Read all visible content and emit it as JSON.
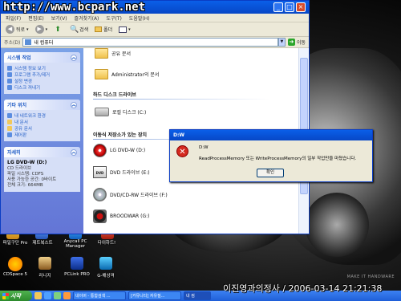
{
  "watermark": {
    "site": "http://www.bcpark.net",
    "caption": "이진영과의정사 / 2006-03-14 21:21:38"
  },
  "wallpaper": {
    "brand": "MAKE IT HANDWARE"
  },
  "explorer": {
    "window_controls": [
      "_",
      "□",
      "×"
    ],
    "menu": [
      "파일(F)",
      "편집(E)",
      "보기(V)",
      "즐겨찾기(A)",
      "도구(T)",
      "도움말(H)"
    ],
    "toolbar": {
      "back": "뒤로",
      "forward": "",
      "search": "검색",
      "folders": "폴더"
    },
    "address": {
      "label": "주소(D)",
      "value": "내 컴퓨터",
      "go": "이동"
    },
    "tasks": {
      "system": {
        "title": "시스템 작업",
        "items": [
          "시스템 정보 보기",
          "프로그램 추가/제거",
          "설정 변경",
          "디스크 꺼내기"
        ]
      },
      "other": {
        "title": "기타 위치",
        "items": [
          "내 네트워크 환경",
          "내 문서",
          "공유 문서",
          "제어판"
        ]
      },
      "details": {
        "title": "자세히",
        "lines": [
          "LG DVD-W (D:)",
          "CD 드라이브",
          "파일 시스템: CDFS",
          "사용 가능한 공간: 0바이트",
          "전체 크기: 664MB"
        ]
      }
    },
    "items": {
      "shared_docs": "공유 문서",
      "admin_docs": "Administrator의 문서",
      "section_hdd": "하드 디스크 드라이브",
      "local_disk": "로컬 디스크 (C:)",
      "section_removable": "이동식 저장소가 있는 장치",
      "dvd_d": "LG DVD-W (D:)",
      "dvd_e": "DVD 드라이브 (E:)",
      "dvd_f": "DVD/CD-RW 드라이브 (F:)",
      "broodwar": "BROODWAR (G:)"
    }
  },
  "dialog": {
    "title": "D:W",
    "path": "D:W",
    "message": "ReadProcessMemory 또는 WriteProcessMemory의 일부 작업만을 마쳤습니다.",
    "ok": "확인"
  },
  "desktop": {
    "icons_row1": [
      "파일구단 Pro",
      "제트복스트",
      "Anycall PC Manager",
      "다이하드!"
    ],
    "icons_row2": [
      "CDSpace 5",
      "리니지",
      "PCLink PRO",
      "G-해상격"
    ]
  },
  "taskbar": {
    "start": "시작",
    "buttons": [
      "네이버 - 통합검색 ...",
      "[커뮤니티] 자유질...",
      "내 컴"
    ]
  }
}
